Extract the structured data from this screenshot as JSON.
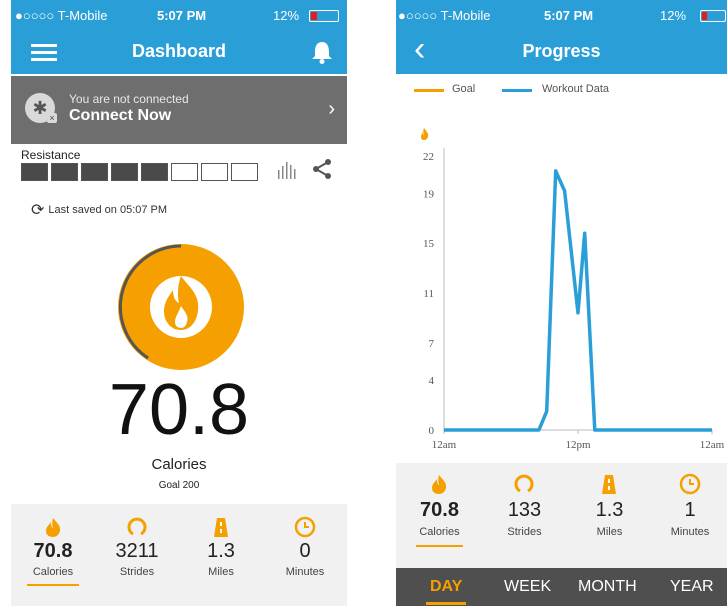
{
  "colors": {
    "accent": "#f5a000",
    "header": "#2a9fd7",
    "banner": "#6e6e6e",
    "series": "#2a9fd7",
    "goal": "#f5a000"
  },
  "status": {
    "carrier": "●○○○○ T-Mobile",
    "time": "5:07 PM",
    "battery": "12%"
  },
  "dashboard": {
    "title": "Dashboard",
    "menu_icon": "hamburger-icon",
    "bell_icon": "bell-icon",
    "banner": {
      "subtitle": "You are not connected",
      "title": "Connect Now",
      "chevron": "›"
    },
    "resistance": {
      "label": "Resistance",
      "filled": 5,
      "total": 8
    },
    "saved": {
      "text": "Last saved on 05:07 PM"
    },
    "main_value": "70.8",
    "main_label": "Calories",
    "goal": "Goal 200",
    "stats": [
      {
        "value": "70.8",
        "label": "Calories",
        "icon": "flame-icon"
      },
      {
        "value": "3211",
        "label": "Strides",
        "icon": "strides-icon"
      },
      {
        "value": "1.3",
        "label": "Miles",
        "icon": "road-icon"
      },
      {
        "value": "0",
        "label": "Minutes",
        "icon": "clock-icon"
      }
    ]
  },
  "progress": {
    "title": "Progress",
    "back": "‹",
    "legend": {
      "goal": "Goal",
      "workout": "Workout Data"
    },
    "stats": [
      {
        "value": "70.8",
        "label": "Calories",
        "icon": "flame-icon"
      },
      {
        "value": "133",
        "label": "Strides",
        "icon": "strides-icon"
      },
      {
        "value": "1.3",
        "label": "Miles",
        "icon": "road-icon"
      },
      {
        "value": "1",
        "label": "Minutes",
        "icon": "clock-icon"
      }
    ],
    "tabs": [
      "DAY",
      "WEEK",
      "MONTH",
      "YEAR"
    ],
    "active_tab": 0
  },
  "chart_data": {
    "type": "line",
    "x_ticks": [
      "12am",
      "12pm",
      "12am"
    ],
    "y_ticks": [
      0,
      4,
      7,
      11,
      15,
      19,
      22
    ],
    "ylim": [
      0,
      22
    ],
    "xlim": [
      0,
      24
    ],
    "grid": false,
    "legend_position": "top-left",
    "series": [
      {
        "name": "Workout Data",
        "x": [
          0,
          8.5,
          9.2,
          10.0,
          10.8,
          12.0,
          12.6,
          13.5,
          14.3,
          18.0,
          24.0
        ],
        "y": [
          0,
          0,
          1.5,
          20.8,
          19.2,
          9.4,
          15.8,
          0,
          0,
          0,
          0
        ]
      }
    ]
  }
}
